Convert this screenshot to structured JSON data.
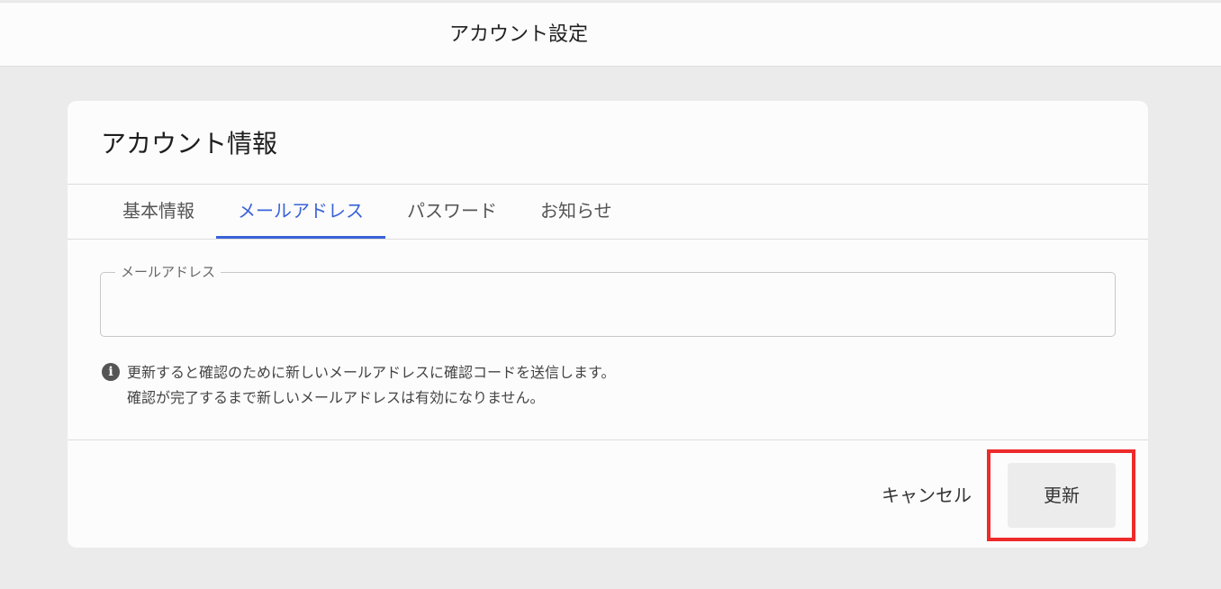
{
  "header": {
    "title": "アカウント設定"
  },
  "card": {
    "title": "アカウント情報",
    "tabs": [
      {
        "label": "基本情報",
        "active": false
      },
      {
        "label": "メールアドレス",
        "active": true
      },
      {
        "label": "パスワード",
        "active": false
      },
      {
        "label": "お知らせ",
        "active": false
      }
    ]
  },
  "email_field": {
    "label": "メールアドレス",
    "value": ""
  },
  "info": {
    "line1": "更新すると確認のために新しいメールアドレスに確認コードを送信します。",
    "line2": "確認が完了するまで新しいメールアドレスは有効になりません。",
    "icon": "info-icon"
  },
  "actions": {
    "cancel_label": "キャンセル",
    "update_label": "更新"
  },
  "colors": {
    "accent": "#3a63d8",
    "highlight": "#ee2b2b",
    "background": "#ebebeb"
  }
}
